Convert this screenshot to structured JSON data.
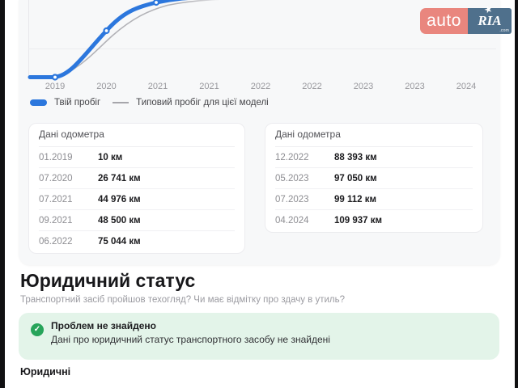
{
  "logo": {
    "auto": "auto",
    "ria": "RIA",
    "star": "★",
    "tld": ".com"
  },
  "colors": {
    "accent_blue": "#2c77dd",
    "typical_gray": "#b2b2b7",
    "logo_salmon": "#e9867e",
    "logo_slate": "#4f708c",
    "success_green": "#27a45a",
    "success_bg": "#e3f4e9"
  },
  "chart": {
    "x_ticks": [
      "2019",
      "2020",
      "2021",
      "2021",
      "2022",
      "2022",
      "2023",
      "2023",
      "2024"
    ],
    "legend": [
      {
        "label": "Твій пробіг"
      },
      {
        "label": "Типовий пробіг для цієї моделі"
      }
    ]
  },
  "chart_data": {
    "type": "line",
    "title": "",
    "xlabel": "",
    "ylabel": "",
    "x_tick_labels": [
      "2019",
      "2020",
      "2021",
      "2021",
      "2022",
      "2022",
      "2023",
      "2023",
      "2024"
    ],
    "legend_position": "bottom",
    "grid": true,
    "series": [
      {
        "name": "Твій пробіг",
        "color": "#2c77dd",
        "unit": "км",
        "x": [
          "01.2019",
          "07.2020",
          "07.2021",
          "09.2021",
          "06.2022",
          "12.2022",
          "05.2023",
          "07.2023",
          "04.2024"
        ],
        "values": [
          10,
          26741,
          44976,
          48500,
          75044,
          88393,
          97050,
          99112,
          109937
        ]
      },
      {
        "name": "Типовий пробіг для цієї моделі",
        "color": "#b2b2b7",
        "x": [],
        "values": []
      }
    ]
  },
  "odometer_cards": [
    {
      "title": "Дані одометра",
      "rows": [
        {
          "date": "01.2019",
          "value": "10 км"
        },
        {
          "date": "07.2020",
          "value": "26 741 км"
        },
        {
          "date": "07.2021",
          "value": "44 976 км"
        },
        {
          "date": "09.2021",
          "value": "48 500 км"
        },
        {
          "date": "06.2022",
          "value": "75 044 км"
        }
      ]
    },
    {
      "title": "Дані одометра",
      "rows": [
        {
          "date": "12.2022",
          "value": "88 393 км"
        },
        {
          "date": "05.2023",
          "value": "97 050 км"
        },
        {
          "date": "07.2023",
          "value": "99 112 км"
        },
        {
          "date": "04.2024",
          "value": "109 937 км"
        }
      ]
    }
  ],
  "legal": {
    "title": "Юридичний статус",
    "subtitle": "Транспортний засіб пройшов техогляд? Чи має відмітку про здачу в утиль?",
    "alert_title": "Проблем не знайдено",
    "alert_text": "Дані про юридичний статус транспортного засобу не знайдені",
    "check_glyph": "✓",
    "footer_label": "Юридичні"
  }
}
